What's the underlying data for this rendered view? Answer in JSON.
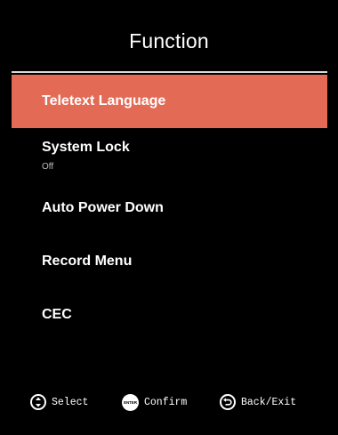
{
  "title": "Function",
  "colors": {
    "selected_background": "#e36b56",
    "background": "#000000",
    "divider": "#d9d9d9"
  },
  "menu": {
    "selected_index": 0,
    "items": [
      {
        "label": "Teletext Language",
        "value": ""
      },
      {
        "label": "System Lock",
        "value": "Off"
      },
      {
        "label": "Auto Power Down",
        "value": ""
      },
      {
        "label": "Record Menu",
        "value": ""
      },
      {
        "label": "CEC",
        "value": ""
      }
    ]
  },
  "footer": {
    "select": {
      "icon": "navigate-icon",
      "label": "Select"
    },
    "confirm": {
      "icon": "enter-icon",
      "icon_text": "ENTER",
      "label": "Confirm"
    },
    "back": {
      "icon": "back-icon",
      "label": "Back/Exit"
    }
  }
}
